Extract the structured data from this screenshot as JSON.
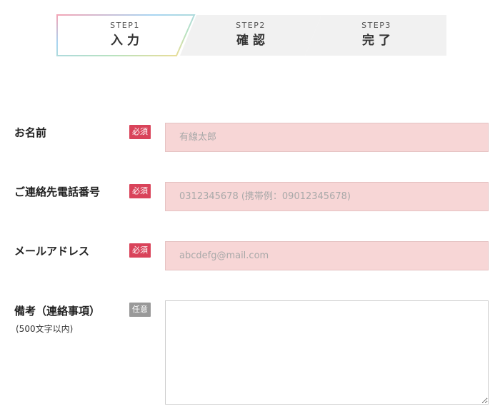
{
  "stepper": {
    "steps": [
      {
        "num": "STEP1",
        "label": "入力",
        "active": true
      },
      {
        "num": "STEP2",
        "label": "確認",
        "active": false
      },
      {
        "num": "STEP3",
        "label": "完了",
        "active": false
      }
    ],
    "colors": {
      "inactive_bg": "#f1f1f1",
      "active_border_gradient": [
        "#f3a5b6",
        "#a8d5f2",
        "#b8e2c0",
        "#f5dc8e"
      ]
    }
  },
  "form": {
    "name": {
      "label": "お名前",
      "badge": "必須",
      "placeholder": "有線太郎"
    },
    "phone": {
      "label": "ご連絡先電話番号",
      "badge": "必須",
      "placeholder": "0312345678 (携帯例：09012345678)"
    },
    "email": {
      "label": "メールアドレス",
      "badge": "必須",
      "placeholder": "abcdefg@mail.com"
    },
    "notes": {
      "label": "備考（連絡事項）",
      "sublabel": "(500文字以内)",
      "badge": "任意"
    }
  },
  "colors": {
    "required_badge": "#d9435a",
    "optional_badge": "#999999",
    "field_bg": "#f7d6d6"
  }
}
